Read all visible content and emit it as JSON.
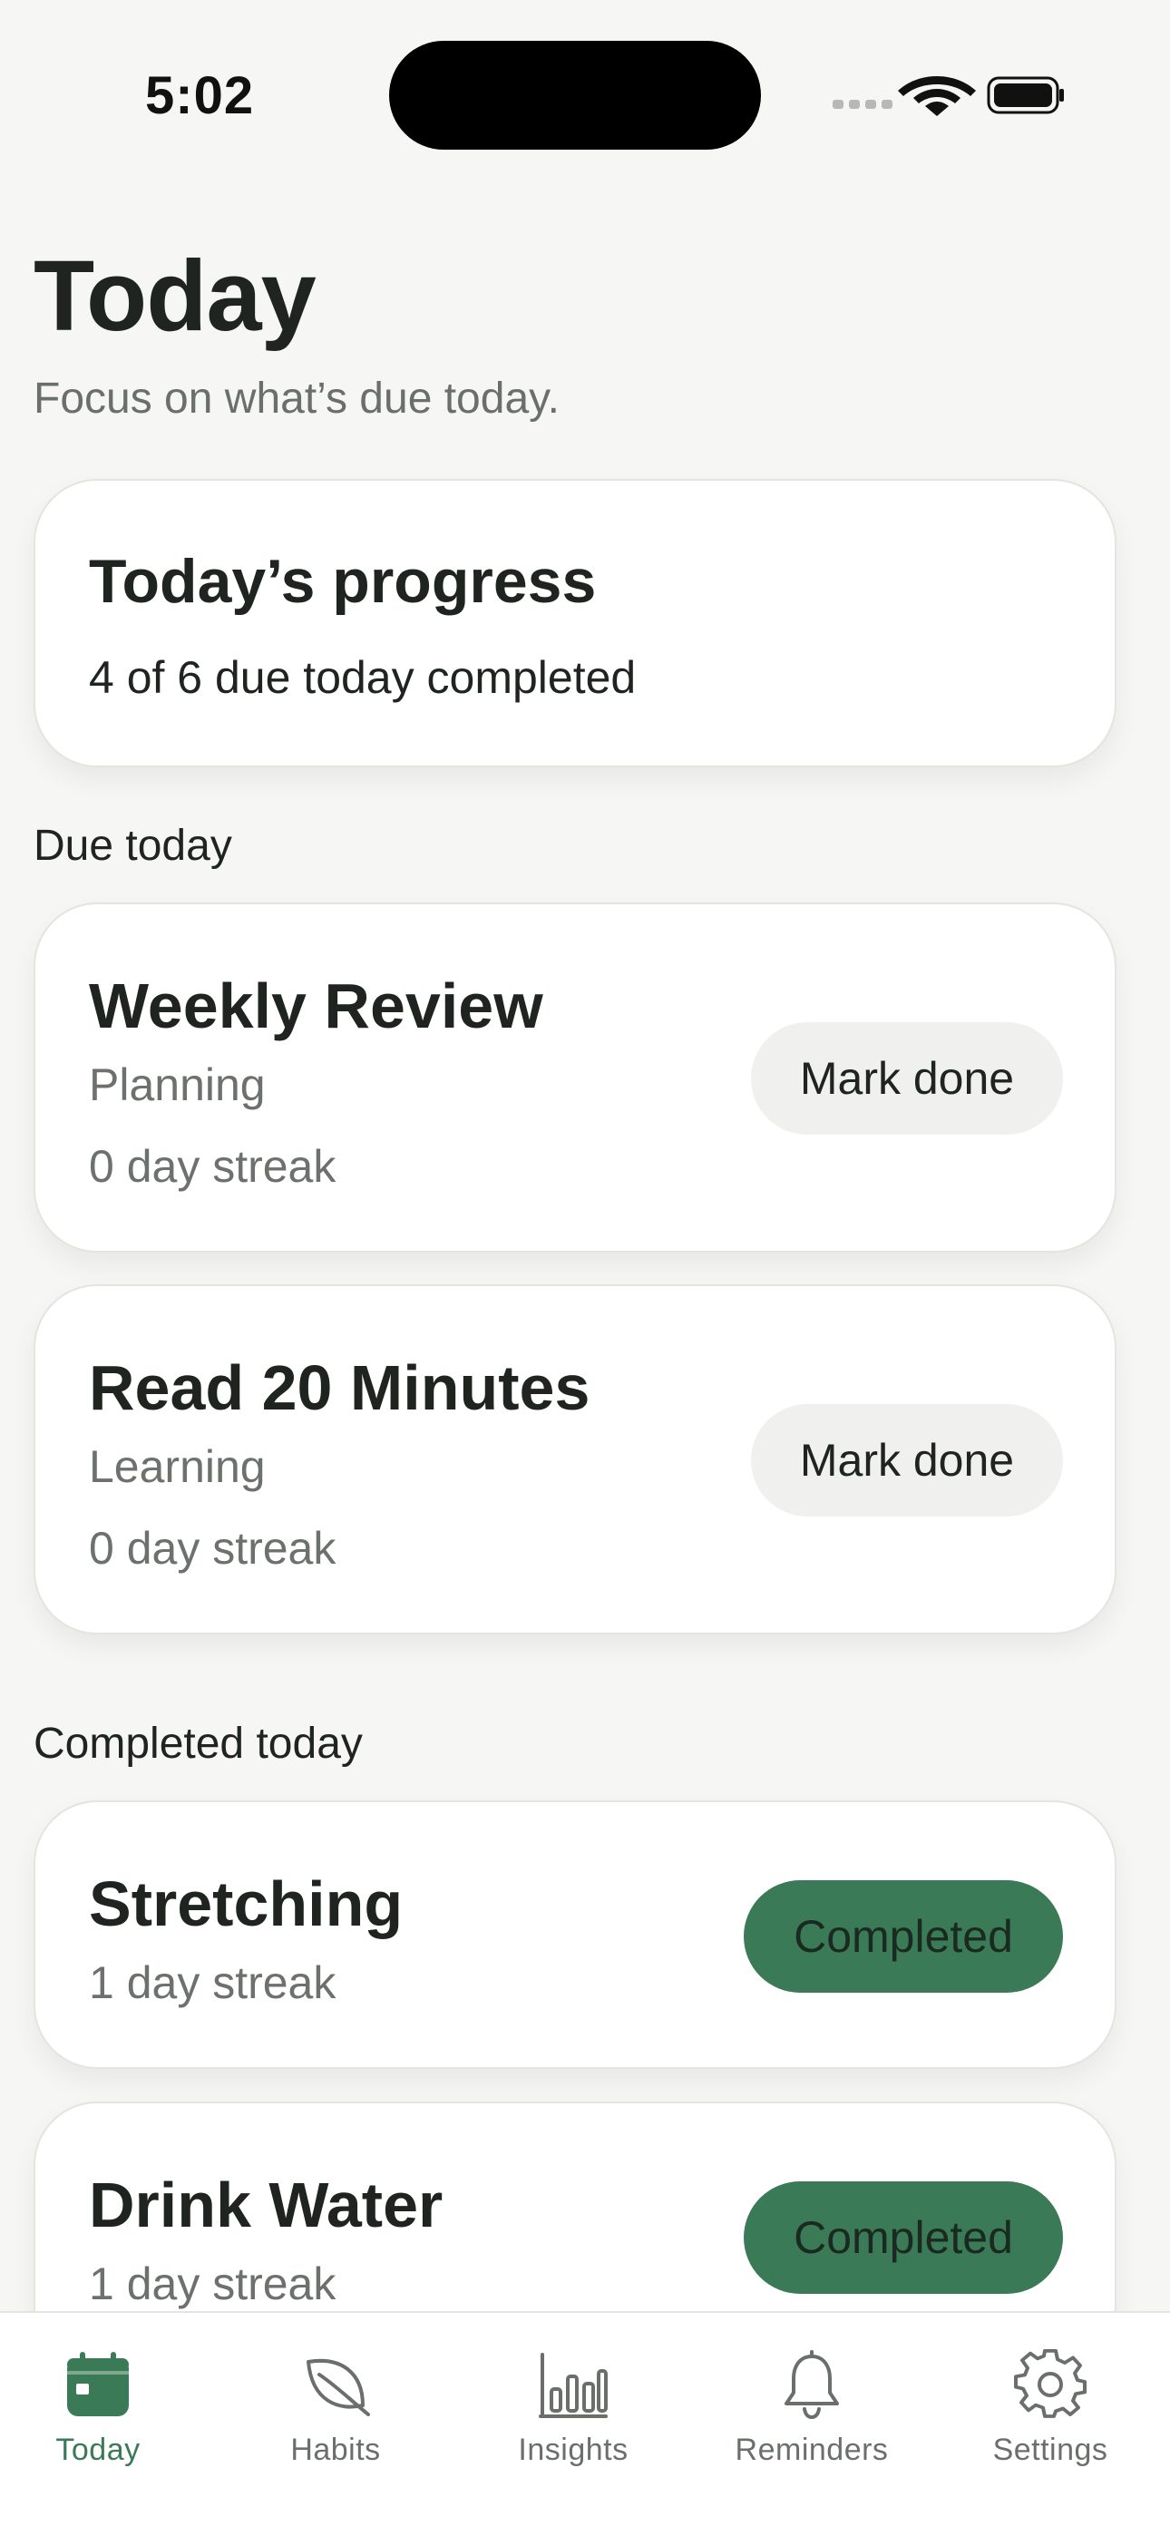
{
  "status_bar": {
    "time": "5:02"
  },
  "header": {
    "title": "Today",
    "subtitle": "Focus on what’s due today."
  },
  "progress": {
    "title": "Today’s progress",
    "summary": "4 of 6 due today completed"
  },
  "due_section": {
    "label": "Due today",
    "items": [
      {
        "title": "Weekly Review",
        "category": "Planning",
        "streak": "0 day streak",
        "action": "Mark done"
      },
      {
        "title": "Read 20 Minutes",
        "category": "Learning",
        "streak": "0 day streak",
        "action": "Mark done"
      }
    ]
  },
  "completed_section": {
    "label": "Completed today",
    "items": [
      {
        "title": "Stretching",
        "streak": "1 day streak",
        "status": "Completed"
      },
      {
        "title": "Drink Water",
        "streak": "1 day streak",
        "status": "Completed"
      }
    ]
  },
  "tab_bar": {
    "tabs": [
      {
        "label": "Today",
        "icon": "calendar-icon",
        "active": true
      },
      {
        "label": "Habits",
        "icon": "leaf-icon",
        "active": false
      },
      {
        "label": "Insights",
        "icon": "bar-chart-icon",
        "active": false
      },
      {
        "label": "Reminders",
        "icon": "bell-icon",
        "active": false
      },
      {
        "label": "Settings",
        "icon": "gear-icon",
        "active": false
      }
    ]
  },
  "colors": {
    "accent": "#3b7a57",
    "background": "#f6f6f4",
    "card": "#ffffff",
    "muted_text": "#6b6f6b",
    "pill_light": "#f0f1ee"
  }
}
